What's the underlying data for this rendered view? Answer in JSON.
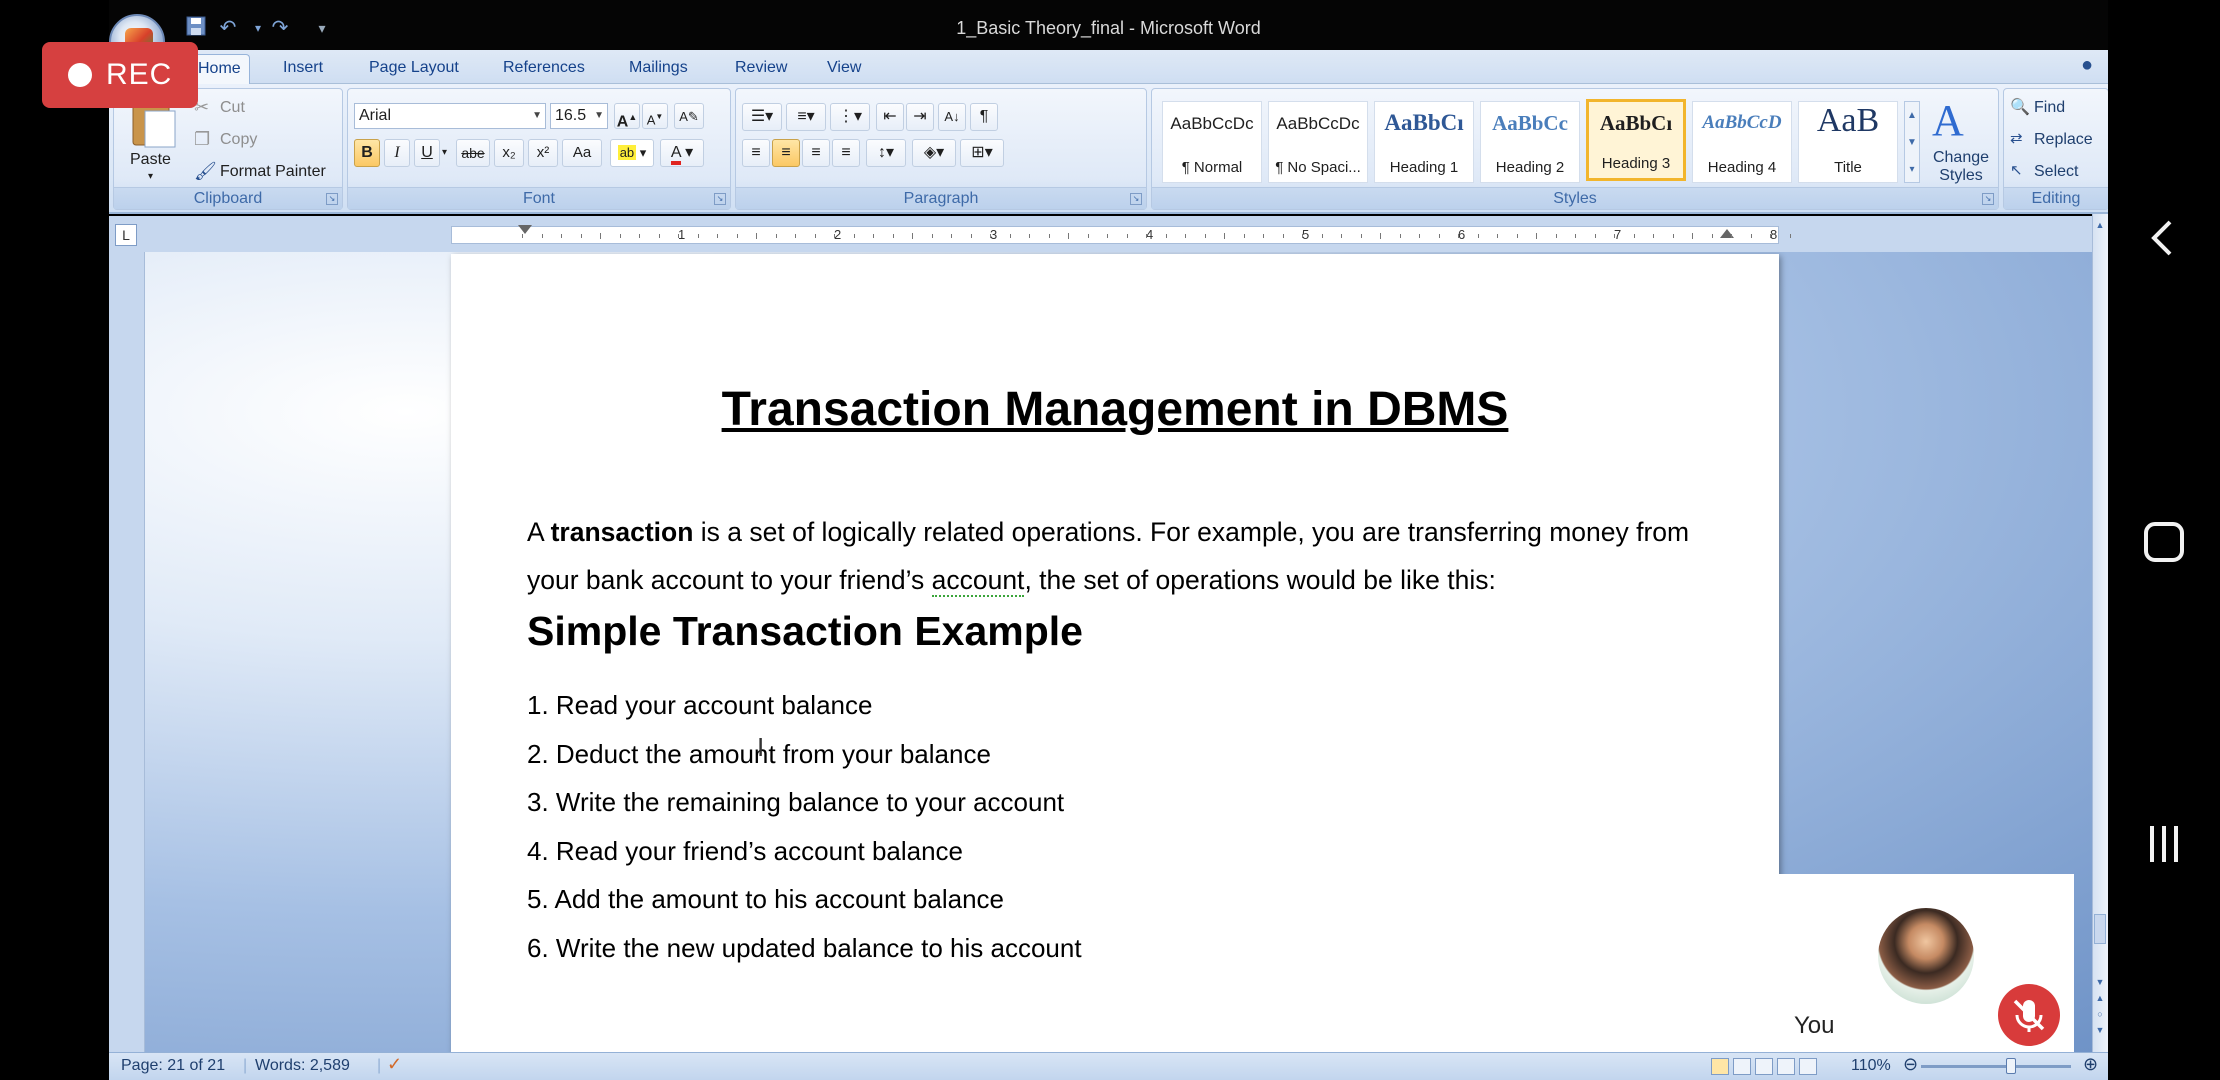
{
  "recording": {
    "label": "REC"
  },
  "window": {
    "title": "1_Basic Theory_final - Microsoft Word"
  },
  "tabs": [
    "Home",
    "Insert",
    "Page Layout",
    "References",
    "Mailings",
    "Review",
    "View"
  ],
  "clipboard": {
    "group_label": "Clipboard",
    "paste": "Paste",
    "cut": "Cut",
    "copy": "Copy",
    "format_painter": "Format Painter"
  },
  "font": {
    "group_label": "Font",
    "family": "Arial",
    "size": "16.5",
    "bold": "B",
    "italic": "I",
    "underline": "U",
    "strike": "abe",
    "subscript": "x₂",
    "superscript": "x²",
    "change_case": "Aa"
  },
  "paragraph": {
    "group_label": "Paragraph"
  },
  "styles": {
    "group_label": "Styles",
    "tiles": [
      {
        "sample": "AaBbCcDc",
        "name": "¶ Normal"
      },
      {
        "sample": "AaBbCcDc",
        "name": "¶ No Spaci..."
      },
      {
        "sample": "AaBbCı",
        "name": "Heading 1"
      },
      {
        "sample": "AaBbCc",
        "name": "Heading 2"
      },
      {
        "sample": "AaBbCı",
        "name": "Heading 3"
      },
      {
        "sample": "AaBbCcD",
        "name": "Heading 4"
      },
      {
        "sample": "AaB",
        "name": "Title"
      }
    ],
    "change_styles": "Change Styles"
  },
  "editing": {
    "group_label": "Editing",
    "find": "Find",
    "replace": "Replace",
    "select": "Select"
  },
  "ruler": {
    "numbers": [
      "1",
      "2",
      "3",
      "4",
      "5",
      "6",
      "7",
      "8"
    ]
  },
  "document": {
    "title": "Transaction Management in DBMS",
    "intro_before": "A ",
    "intro_bold": "transaction",
    "intro_after": " is a set of logically related operations. For example, you are transferring money from your bank account to your friend’s ",
    "intro_squiggle": "account",
    "intro_end": ", the set of operations would be like this:",
    "heading": "Simple Transaction Example",
    "steps": [
      "1. Read your account balance",
      "2. Deduct the amount from your balance",
      "3. Write the remaining balance to your account",
      "4. Read your friend’s account balance",
      "5. Add the amount to his account balance",
      "6. Write the new updated balance to his account"
    ]
  },
  "status": {
    "page": "Page: 21 of 21",
    "words": "Words: 2,589",
    "zoom": "110%"
  },
  "video_call": {
    "participant": "You"
  },
  "colors": {
    "rec": "#d64040",
    "mute": "#d83b3b",
    "ribbon_text": "#15428b"
  }
}
